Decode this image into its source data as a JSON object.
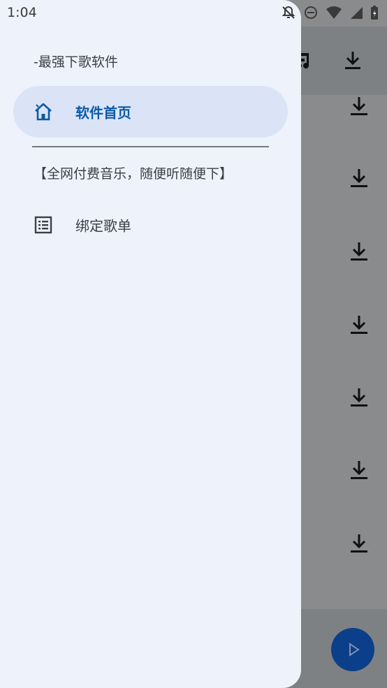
{
  "status_bar": {
    "time": "1:04",
    "icons": [
      "notifications-off-icon",
      "do-not-disturb-icon",
      "wifi-icon",
      "signal-icon",
      "battery-icon"
    ]
  },
  "drawer": {
    "header": "-最强下歌软件",
    "items": [
      {
        "label": "软件首页",
        "icon": "home-icon",
        "active": true
      },
      {
        "label": "绑定歌单",
        "icon": "list-icon",
        "active": false
      }
    ],
    "section_label": "【全网付费音乐，随便听随便下】"
  },
  "background": {
    "partial_text": ")",
    "download_buttons_count": 7
  },
  "colors": {
    "drawer_bg": "#eef2fa",
    "active_pill": "#dbe4f7",
    "accent": "#0b5aa8",
    "fab": "#0b3f8a"
  }
}
